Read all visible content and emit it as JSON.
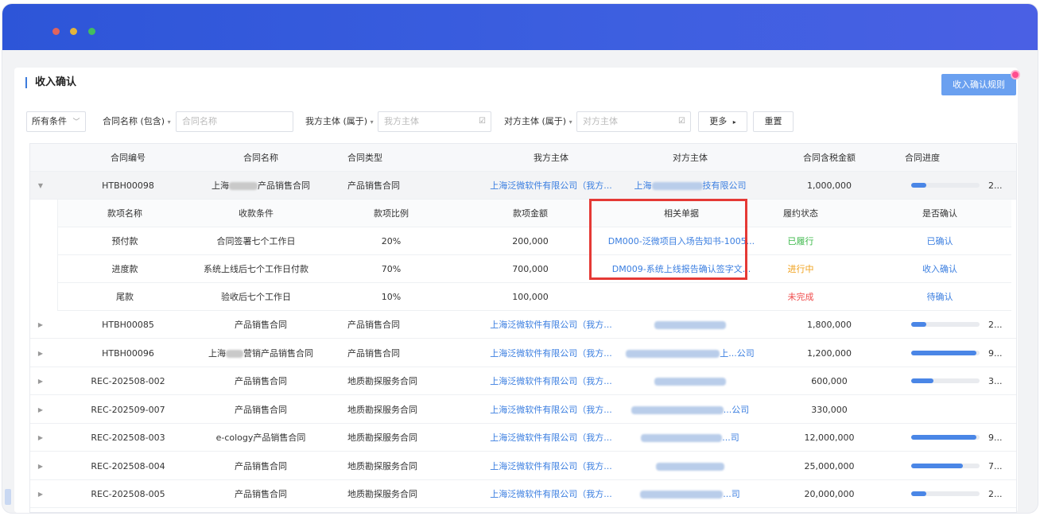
{
  "window": {
    "dots": [
      "#e0645c",
      "#e3b43c",
      "#43bd5e"
    ]
  },
  "page": {
    "title": "收入确认",
    "rule_button": "收入确认规则"
  },
  "filters": {
    "condition": "所有条件",
    "contract_name_label": "合同名称 (包含)",
    "contract_name_placeholder": "合同名称",
    "our_entity_label": "我方主体 (属于)",
    "our_entity_placeholder": "我方主体",
    "counter_entity_label": "对方主体 (属于)",
    "counter_entity_placeholder": "对方主体",
    "more": "更多",
    "reset": "重置"
  },
  "table": {
    "headers": [
      "合同编号",
      "合同名称",
      "合同类型",
      "我方主体",
      "对方主体",
      "合同含税金额",
      "合同进度"
    ],
    "expanded_row": {
      "id": "HTBH00098",
      "name": "上海...产品销售合同",
      "type": "产品销售合同",
      "our": "上海泛微软件有限公司（我方...",
      "counter": "上海...技有限公司",
      "amount": "1,000,000",
      "progress_text": "2...",
      "progress": 0.22
    },
    "sub_headers": [
      "款项名称",
      "收款条件",
      "款项比例",
      "款项金额",
      "相关单据",
      "履约状态",
      "是否确认"
    ],
    "sub_rows": [
      {
        "name": "预付款",
        "condition": "合同签署七个工作日",
        "ratio": "20%",
        "amount": "200,000",
        "doc": "DM000-泛微项目入场告知书-1005...",
        "status": "已履行",
        "confirm": "已确认"
      },
      {
        "name": "进度款",
        "condition": "系统上线后七个工作日付款",
        "ratio": "70%",
        "amount": "700,000",
        "doc": "DM009-系统上线报告确认签字文...",
        "status": "进行中",
        "confirm": "收入确认"
      },
      {
        "name": "尾款",
        "condition": "验收后七个工作日",
        "ratio": "10%",
        "amount": "100,000",
        "doc": "",
        "status": "未完成",
        "confirm": "待确认"
      }
    ],
    "rows": [
      {
        "id": "HTBH00085",
        "name": "产品销售合同",
        "type": "产品销售合同",
        "our": "上海泛微软件有限公司（我方...",
        "counter": "",
        "amount": "1,800,000",
        "progress_text": "2...",
        "progress": 0.22
      },
      {
        "id": "HTBH00096",
        "name": "上海...营销产品销售合同",
        "type": "产品销售合同",
        "our": "上海泛微软件有限公司（我方...",
        "counter": "上...公司",
        "amount": "1,200,000",
        "progress_text": "9...",
        "progress": 0.95
      },
      {
        "id": "REC-202508-002",
        "name": "产品销售合同",
        "type": "地质勘探服务合同",
        "our": "上海泛微软件有限公司（我方...",
        "counter": "",
        "amount": "600,000",
        "progress_text": "3...",
        "progress": 0.33
      },
      {
        "id": "REC-202509-007",
        "name": "产品销售合同",
        "type": "地质勘探服务合同",
        "our": "上海泛微软件有限公司（我方...",
        "counter": "...公司",
        "amount": "330,000",
        "progress_text": "",
        "progress": 0
      },
      {
        "id": "REC-202508-003",
        "name": "e-cology产品销售合同",
        "type": "地质勘探服务合同",
        "our": "上海泛微软件有限公司（我方...",
        "counter": "...司",
        "amount": "12,000,000",
        "progress_text": "9...",
        "progress": 0.95
      },
      {
        "id": "REC-202508-004",
        "name": "产品销售合同",
        "type": "地质勘探服务合同",
        "our": "上海泛微软件有限公司（我方...",
        "counter": "",
        "amount": "25,000,000",
        "progress_text": "7...",
        "progress": 0.75
      },
      {
        "id": "REC-202508-005",
        "name": "产品销售合同",
        "type": "地质勘探服务合同",
        "our": "上海泛微软件有限公司（我方...",
        "counter": "...司",
        "amount": "20,000,000",
        "progress_text": "2...",
        "progress": 0.22
      }
    ]
  },
  "colors": {
    "accent": "#3a7ee0",
    "highlight_box": "#e53935",
    "titlebar": "#3d5fe0"
  }
}
